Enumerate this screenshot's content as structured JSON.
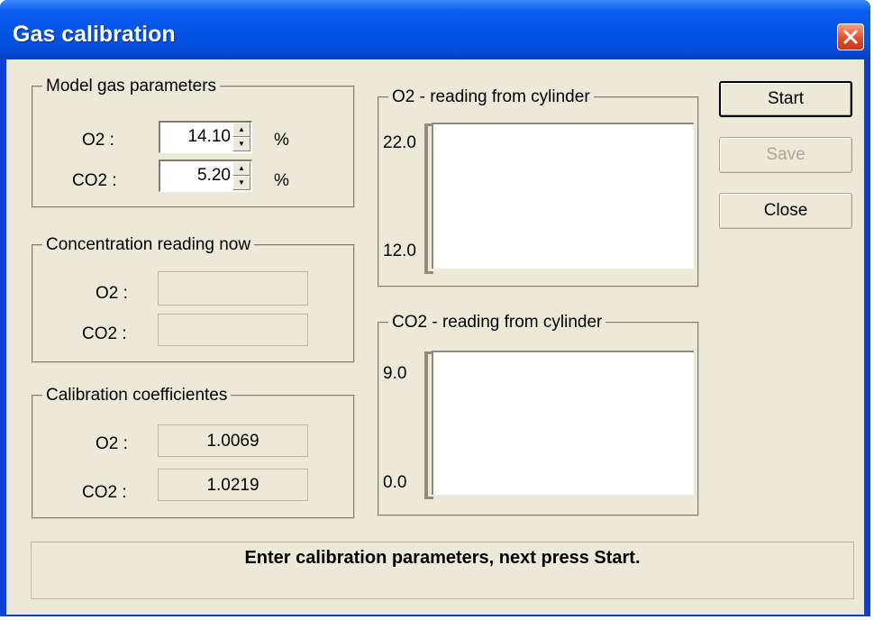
{
  "window": {
    "title": "Gas calibration"
  },
  "model_gas": {
    "legend": "Model gas parameters",
    "o2_label": "O2 :",
    "o2_value": "14.10",
    "o2_unit": "%",
    "co2_label": "CO2 :",
    "co2_value": "5.20",
    "co2_unit": "%"
  },
  "concentration": {
    "legend": "Concentration reading now",
    "o2_label": "O2 :",
    "o2_value": "",
    "co2_label": "CO2 :",
    "co2_value": ""
  },
  "coefficients": {
    "legend": "Calibration coefficientes",
    "o2_label": "O2 :",
    "o2_value": "1.0069",
    "co2_label": "CO2 :",
    "co2_value": "1.0219"
  },
  "o2_chart": {
    "legend": "O2 - reading from cylinder",
    "y_max": "22.0",
    "y_min": "12.0"
  },
  "co2_chart": {
    "legend": "CO2 - reading from cylinder",
    "y_max": "9.0",
    "y_min": "0.0"
  },
  "buttons": {
    "start": "Start",
    "save": "Save",
    "close": "Close"
  },
  "status": {
    "message": "Enter calibration parameters, next press Start."
  },
  "icons": {
    "close": "close-x-icon",
    "spin_up": "spin-up-arrow-icon",
    "spin_down": "spin-down-arrow-icon"
  },
  "colors": {
    "titlebar": "#0454e6",
    "close_button": "#e24d2a",
    "dialog_bg": "#ece9d8",
    "disabled_text": "#aca899"
  }
}
